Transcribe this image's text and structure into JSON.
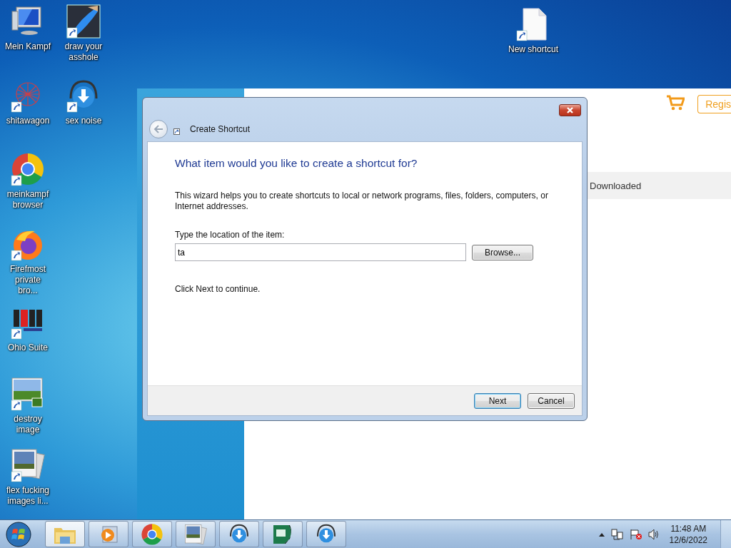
{
  "desktop_icons": [
    {
      "label": "Mein Kampf",
      "kind": "computer",
      "shortcut": false
    },
    {
      "label": "draw your asshole",
      "kind": "paint",
      "shortcut": true
    },
    {
      "label": "shitawagon",
      "kind": "network",
      "shortcut": true
    },
    {
      "label": "sex noise",
      "kind": "headphones",
      "shortcut": true
    },
    {
      "label": "meinkampf browser",
      "kind": "chrome",
      "shortcut": true
    },
    {
      "label": "Firefmost private bro...",
      "kind": "firefox",
      "shortcut": true
    },
    {
      "label": "Ohio Suite",
      "kind": "nch",
      "shortcut": true
    },
    {
      "label": "destroy image",
      "kind": "image",
      "shortcut": true
    },
    {
      "label": "flex fucking images li...",
      "kind": "photos",
      "shortcut": true
    },
    {
      "label": "New shortcut",
      "kind": "file",
      "shortcut": true
    }
  ],
  "background_window": {
    "button_label": "Regis",
    "column_label": "Downloaded"
  },
  "dialog": {
    "title": "Create Shortcut",
    "heading": "What item would you like to create a shortcut for?",
    "description": "This wizard helps you to create shortcuts to local or network programs, files, folders, computers, or Internet addresses.",
    "field_label": "Type the location of the item:",
    "field_value": "ta",
    "browse_label": "Browse...",
    "instruction": "Click Next to continue.",
    "buttons": [
      {
        "label": "Next",
        "default": true
      },
      {
        "label": "Cancel",
        "default": false
      }
    ]
  },
  "taskbar": {
    "items": [
      {
        "kind": "explorer",
        "active": true
      },
      {
        "kind": "media",
        "active": false
      },
      {
        "kind": "chrome",
        "active": false
      },
      {
        "kind": "photos",
        "active": false
      },
      {
        "kind": "headphones",
        "active": false
      },
      {
        "kind": "pc",
        "active": false
      },
      {
        "kind": "headphones",
        "active": false
      }
    ],
    "clock": {
      "time": "11:48 AM",
      "date": "12/6/2022"
    }
  }
}
